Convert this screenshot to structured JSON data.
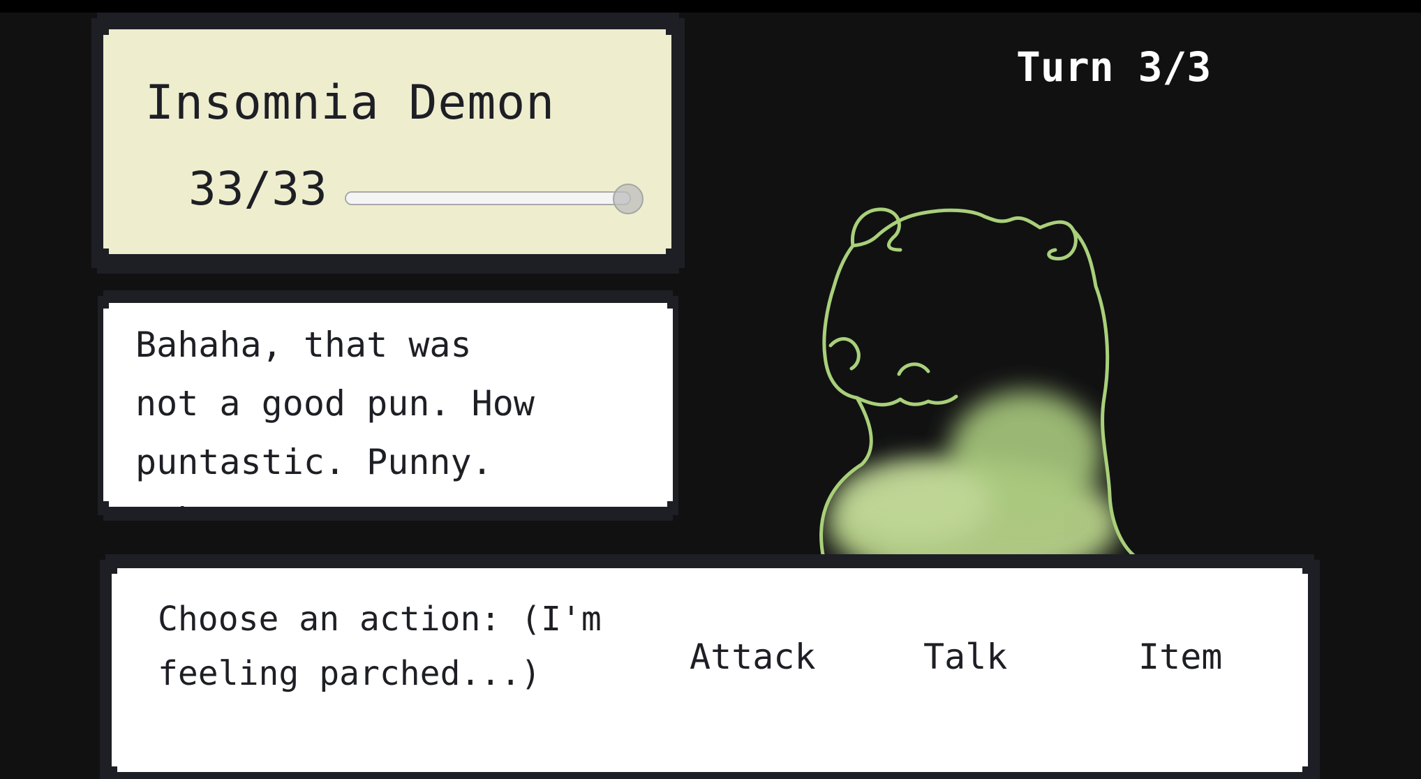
{
  "enemy": {
    "name": "Insomnia Demon",
    "hp_text": "33/33",
    "hp_current": 33,
    "hp_max": 33
  },
  "turn": {
    "label": "Turn 3/3"
  },
  "dialogue": {
    "text": "Bahaha, that was not a good pun. How puntastic. Punny. Hehe."
  },
  "actions": {
    "prompt": "Choose an action: (I'm feeling parched...)",
    "attack_label": "Attack",
    "talk_label": "Talk",
    "item_label": "Item"
  },
  "colors": {
    "background": "#111112",
    "panel_border": "#1e1f25",
    "enemy_panel": "#eeeecf",
    "demon_outline": "#a9d07a",
    "demon_fog": "#b7d189",
    "text": "#1e1f25"
  },
  "sprite": {
    "name": "insomnia-demon-sprite"
  }
}
